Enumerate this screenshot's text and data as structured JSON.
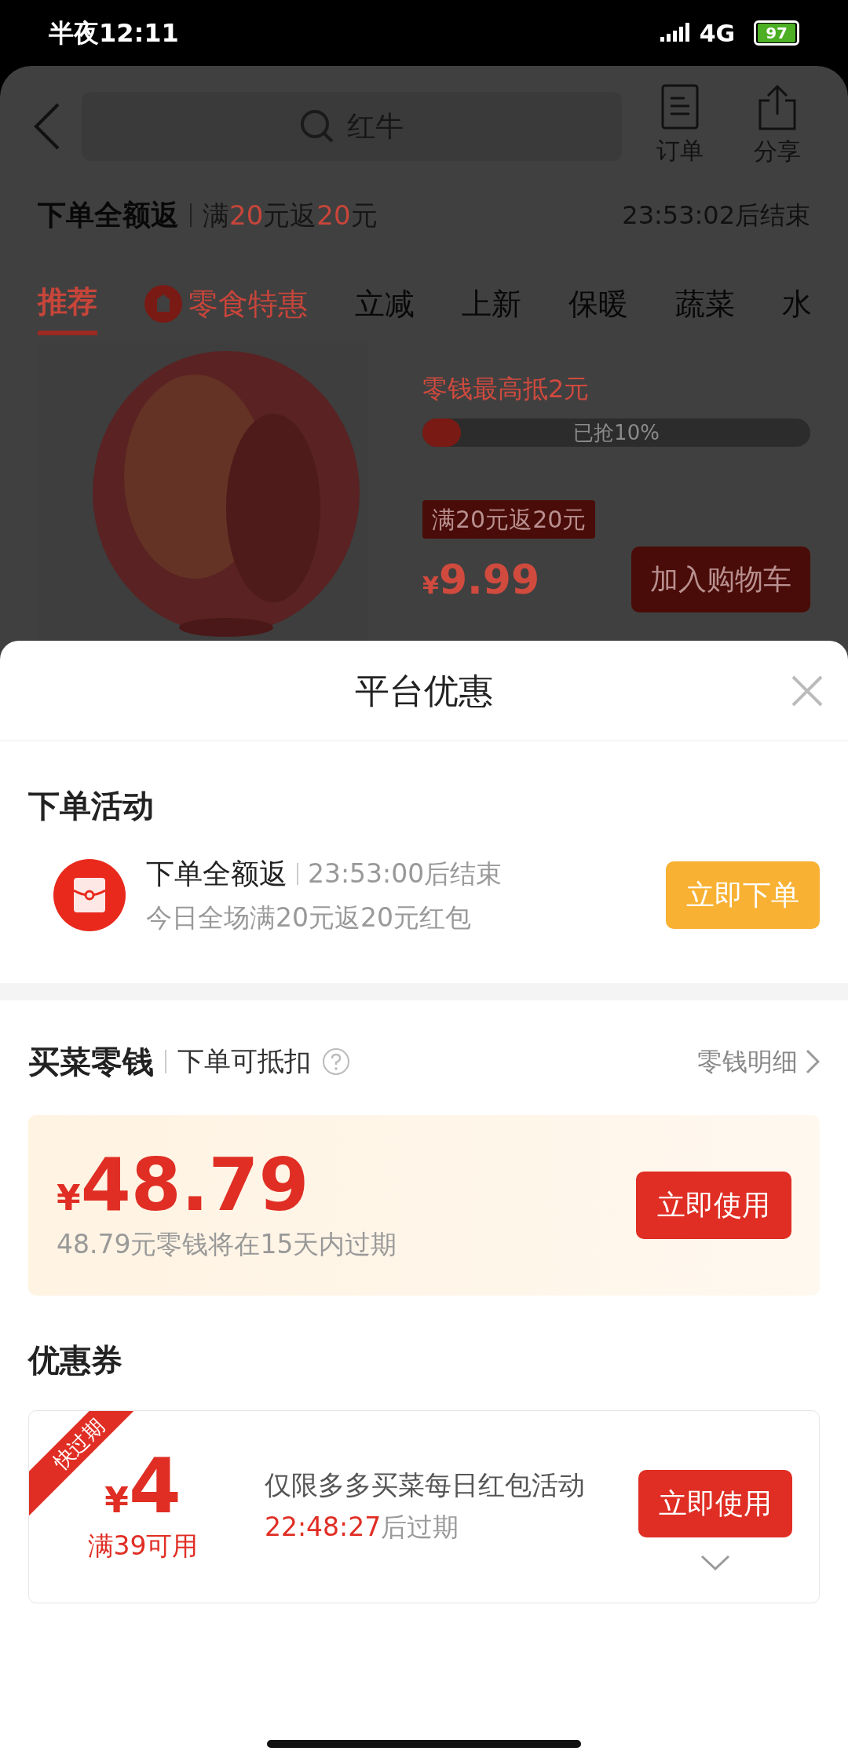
{
  "status_bar": {
    "time": "半夜12:11",
    "network": "4G",
    "battery": "97"
  },
  "header": {
    "search_placeholder": "红牛",
    "actions": [
      {
        "label": "订单",
        "kind": "list"
      },
      {
        "label": "分享",
        "kind": "share"
      }
    ]
  },
  "promo_banner": {
    "title": "下单全额返",
    "rule": "满**20**元返**20**元",
    "countdown": "23:53:02后结束"
  },
  "tabs": [
    {
      "label": "推荐",
      "selected": true,
      "kind": "plain"
    },
    {
      "label": "零食特惠",
      "selected": false,
      "kind": "promo"
    },
    {
      "label": "立减",
      "selected": false,
      "kind": "plain"
    },
    {
      "label": "上新",
      "selected": false,
      "kind": "plain"
    },
    {
      "label": "保暖",
      "selected": false,
      "kind": "plain"
    },
    {
      "label": "蔬菜",
      "selected": false,
      "kind": "plain"
    },
    {
      "label": "水",
      "selected": false,
      "kind": "plain"
    }
  ],
  "product": {
    "kind": "picture",
    "deduction": "零钱最高抵2元",
    "progress_label": "已抢10%",
    "level": 0.1,
    "tag": "满20元返20元",
    "currency": "¥",
    "price": "9.99",
    "button": "加入购物车"
  },
  "sheet": {
    "title": "平台优惠",
    "activity": {
      "heading": "下单活动",
      "name": "下单全额返",
      "countdown": "23:53:00后结束",
      "description": "今日全场满20元返20元红包",
      "button": "立即下单"
    },
    "change": {
      "heading": "买菜零钱",
      "subheading": "下单可抵扣",
      "link": "零钱明细",
      "currency": "¥",
      "amount": "48.79",
      "note": "48.79元零钱将在15天内过期",
      "button": "立即使用"
    },
    "coupons": {
      "heading": "优惠券",
      "items": [
        {
          "badge": "快过期",
          "currency": "¥",
          "amount": "4",
          "condition": "满39可用",
          "description": "仅限多多买菜每日红包活动",
          "expiry_time": "22:48:27",
          "expiry_suffix": "后过期",
          "button": "立即使用"
        }
      ]
    }
  }
}
